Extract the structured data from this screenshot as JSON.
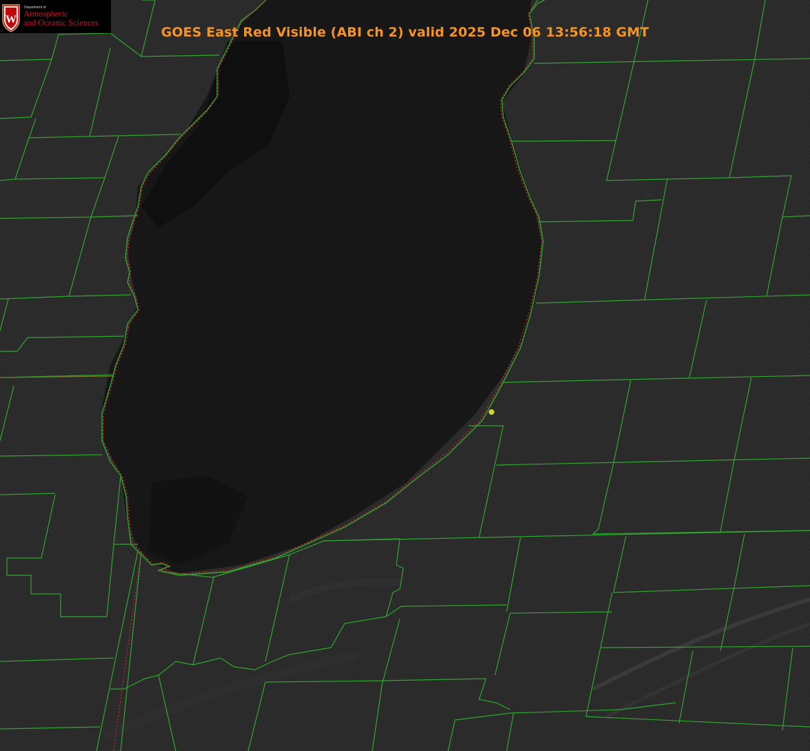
{
  "header": {
    "title": "GOES East Red Visible (ABI ch 2) valid 2025 Dec 06 13:56:18 GMT"
  },
  "logo": {
    "crest_letter": "W",
    "department_label": "Department of",
    "name_line1": "Atmospheric",
    "name_line2": "and Oceanic Sciences"
  },
  "map": {
    "overlay_color": "#2fa82f",
    "lake_shoreline_color": "#e0202a",
    "marker_color": "#d4d42a",
    "background_color": "#1c1c1c"
  },
  "icons": [
    "uw-crest-icon",
    "location-marker-icon"
  ]
}
